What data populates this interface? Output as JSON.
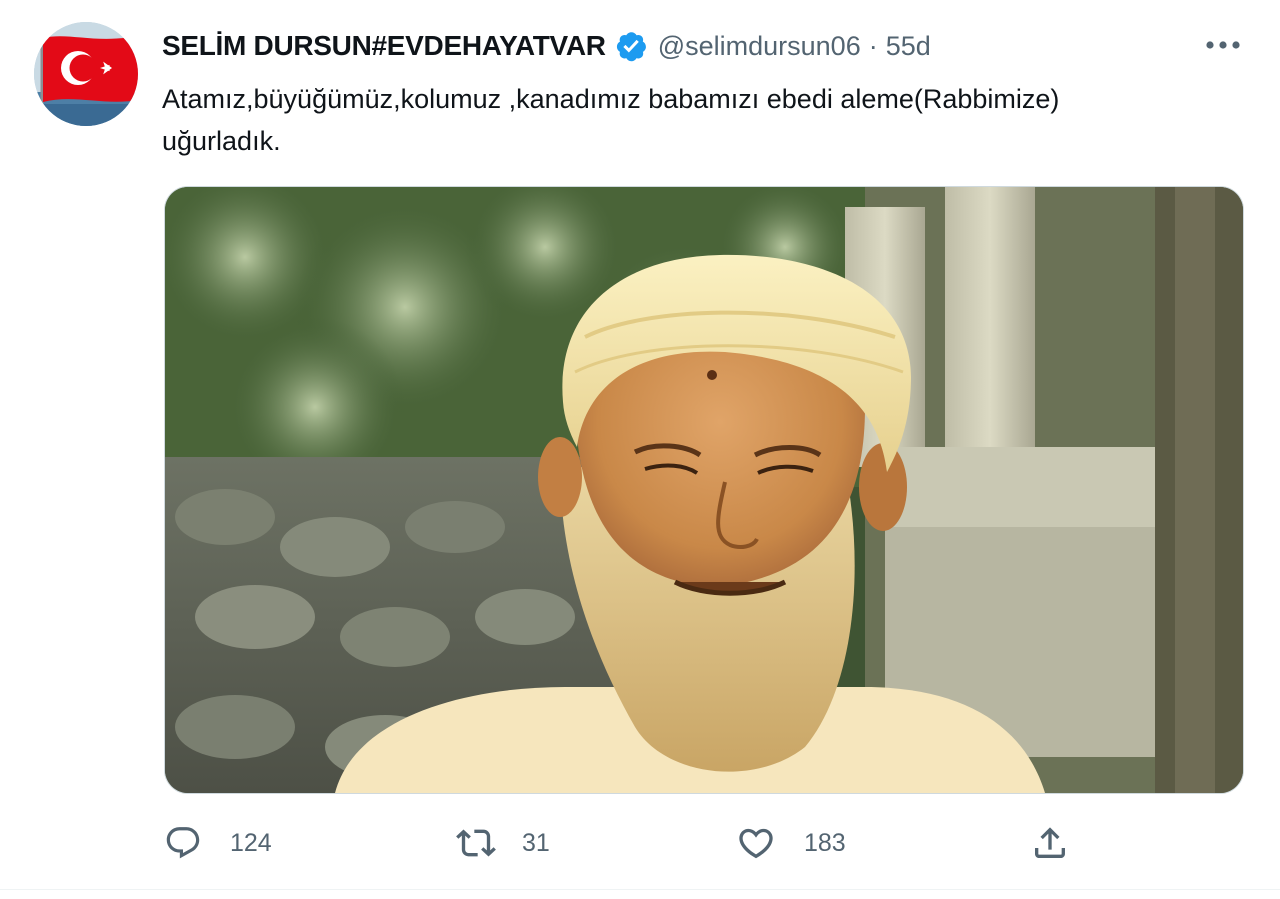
{
  "tweet": {
    "display_name": "SELİM DURSUN#EVDEHAYATVAR",
    "handle": "@selimdursun06",
    "separator": "·",
    "time": "55d",
    "text_line1": "Atamız,büyüğümüz,kolumuz ,kanadımız babamızı ebedi aleme(Rabbimize)",
    "text_line2": "uğurladık.",
    "verified": true
  },
  "icons": {
    "avatar": "turkish-flag-avatar",
    "verified": "verified-badge-icon",
    "more": "more-horizontal-icon",
    "reply": "reply-icon",
    "retweet": "retweet-icon",
    "like": "heart-icon",
    "share": "share-icon"
  },
  "actions": {
    "replies": "124",
    "retweets": "31",
    "likes": "183"
  },
  "colors": {
    "accent": "#1d9bf0",
    "secondary_text": "#536471",
    "primary_text": "#0f1419",
    "flag_red": "#e30a17"
  }
}
